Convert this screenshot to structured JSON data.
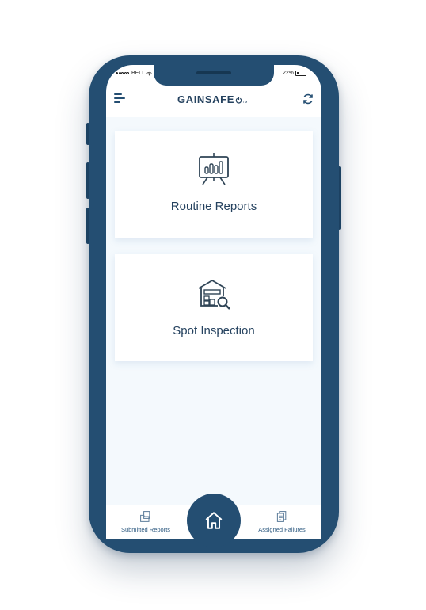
{
  "status_bar": {
    "carrier": "BELL",
    "battery_percent": "22%"
  },
  "header": {
    "logo_text": "GAINSAFE",
    "logo_tm": "TM",
    "menu_icon": "hamburger-icon",
    "refresh_icon": "refresh-icon"
  },
  "cards": [
    {
      "label": "Routine Reports",
      "icon": "presentation-chart-icon"
    },
    {
      "label": "Spot Inspection",
      "icon": "warehouse-search-icon"
    }
  ],
  "bottom_nav": {
    "submitted_label": "Submitted Reports",
    "assigned_label": "Assigned Failures",
    "home_icon": "home-icon"
  },
  "colors": {
    "phone_body": "#244e72",
    "text_primary": "#25425f",
    "content_background": "#f4f9fd"
  }
}
